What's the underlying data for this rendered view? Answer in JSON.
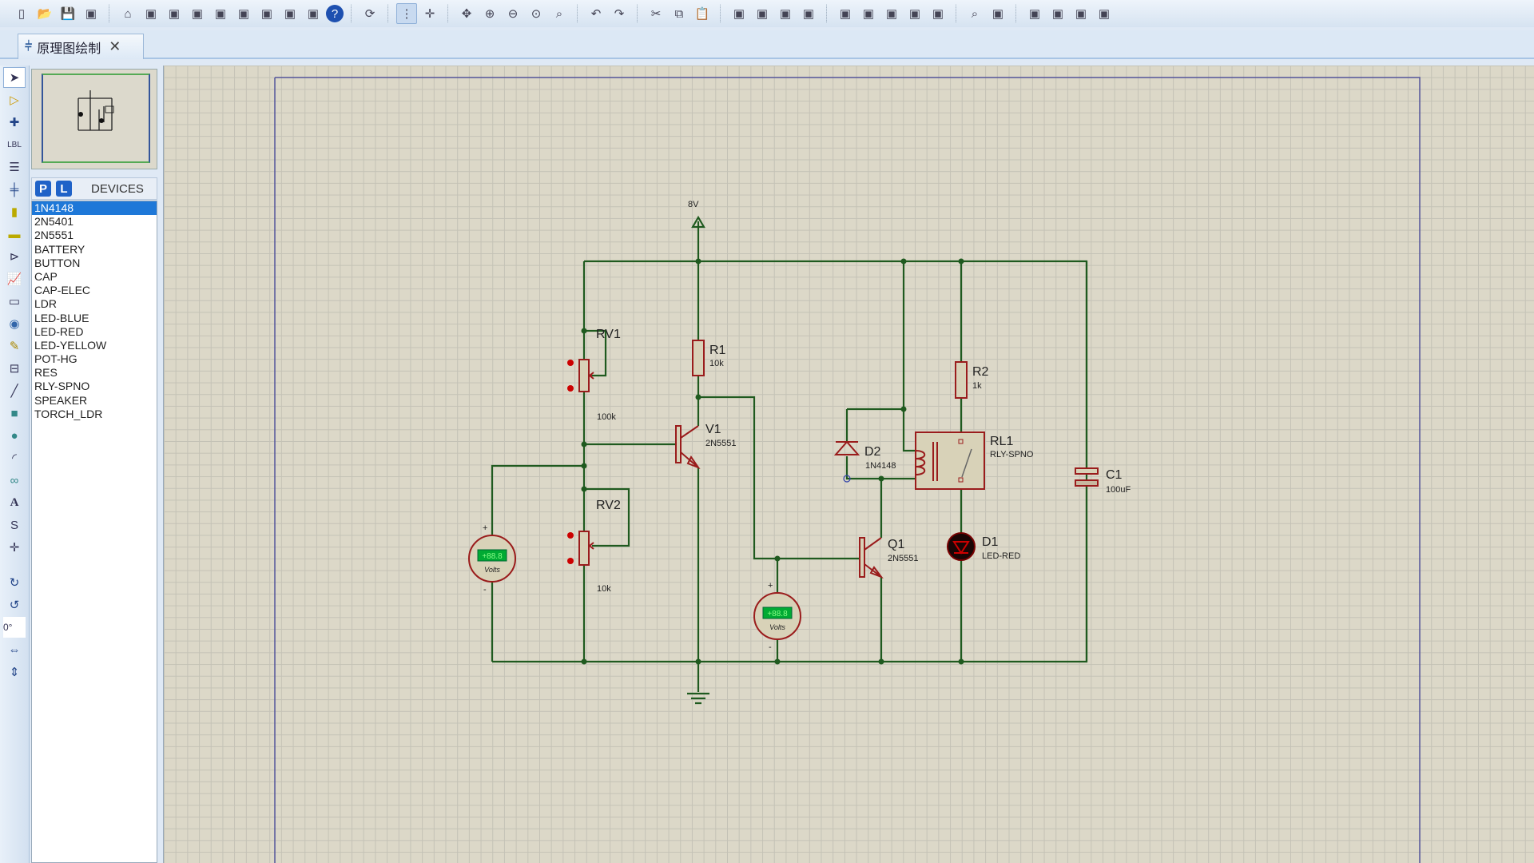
{
  "toolbar": {
    "icons": [
      "new-file-icon",
      "open-folder-icon",
      "save-icon",
      "import-icon",
      "home-icon",
      "schematic-icon",
      "pcb-icon",
      "gerber-icon",
      "3d-viewer-icon",
      "bom-icon",
      "design-explorer-icon",
      "script-icon",
      "notes-icon",
      "help-icon",
      "refresh-icon",
      "grid-icon",
      "origin-icon",
      "pan-icon",
      "zoom-in-icon",
      "zoom-out-icon",
      "zoom-all-icon",
      "zoom-area-icon",
      "undo-icon",
      "redo-icon",
      "cut-icon",
      "copy-icon",
      "paste-icon",
      "block-copy-icon",
      "block-move-icon",
      "block-rotate-icon",
      "block-delete-icon",
      "pick-device-icon",
      "make-device-icon",
      "packaging-icon",
      "decompose-icon",
      "wire-autorouter-icon",
      "search-icon",
      "property-tool-icon",
      "new-sheet-icon",
      "delete-sheet-icon",
      "goto-sheet-icon",
      "netlist-icon"
    ]
  },
  "tab": {
    "label": "原理图绘制",
    "close": "✕"
  },
  "left_tools": {
    "rotation": "0°"
  },
  "devices": {
    "p_button": "P",
    "l_button": "L",
    "title": "DEVICES",
    "selected": "1N4148",
    "items": [
      "1N4148",
      "2N5401",
      "2N5551",
      "BATTERY",
      "BUTTON",
      "CAP",
      "CAP-ELEC",
      "LDR",
      "LED-BLUE",
      "LED-RED",
      "LED-YELLOW",
      "POT-HG",
      "RES",
      "RLY-SPNO",
      "SPEAKER",
      "TORCH_LDR"
    ]
  },
  "schematic": {
    "power": "8V",
    "RV1": {
      "ref": "RV1",
      "value": "100k"
    },
    "RV2": {
      "ref": "RV2",
      "value": "10k"
    },
    "R1": {
      "ref": "R1",
      "value": "10k"
    },
    "R2": {
      "ref": "R2",
      "value": "1k"
    },
    "V1": {
      "ref": "V1",
      "value": "2N5551"
    },
    "Q1": {
      "ref": "Q1",
      "value": "2N5551"
    },
    "D2": {
      "ref": "D2",
      "value": "1N4148"
    },
    "RL1": {
      "ref": "RL1",
      "value": "RLY-SPNO"
    },
    "D1": {
      "ref": "D1",
      "value": "LED-RED"
    },
    "C1": {
      "ref": "C1",
      "value": "100uF"
    },
    "voltmeter": {
      "display": "+88.8",
      "unit": "Volts",
      "plus": "+",
      "minus": "-"
    },
    "wire_color": "#1f5a1f",
    "component_color": "#9a1c1c"
  }
}
